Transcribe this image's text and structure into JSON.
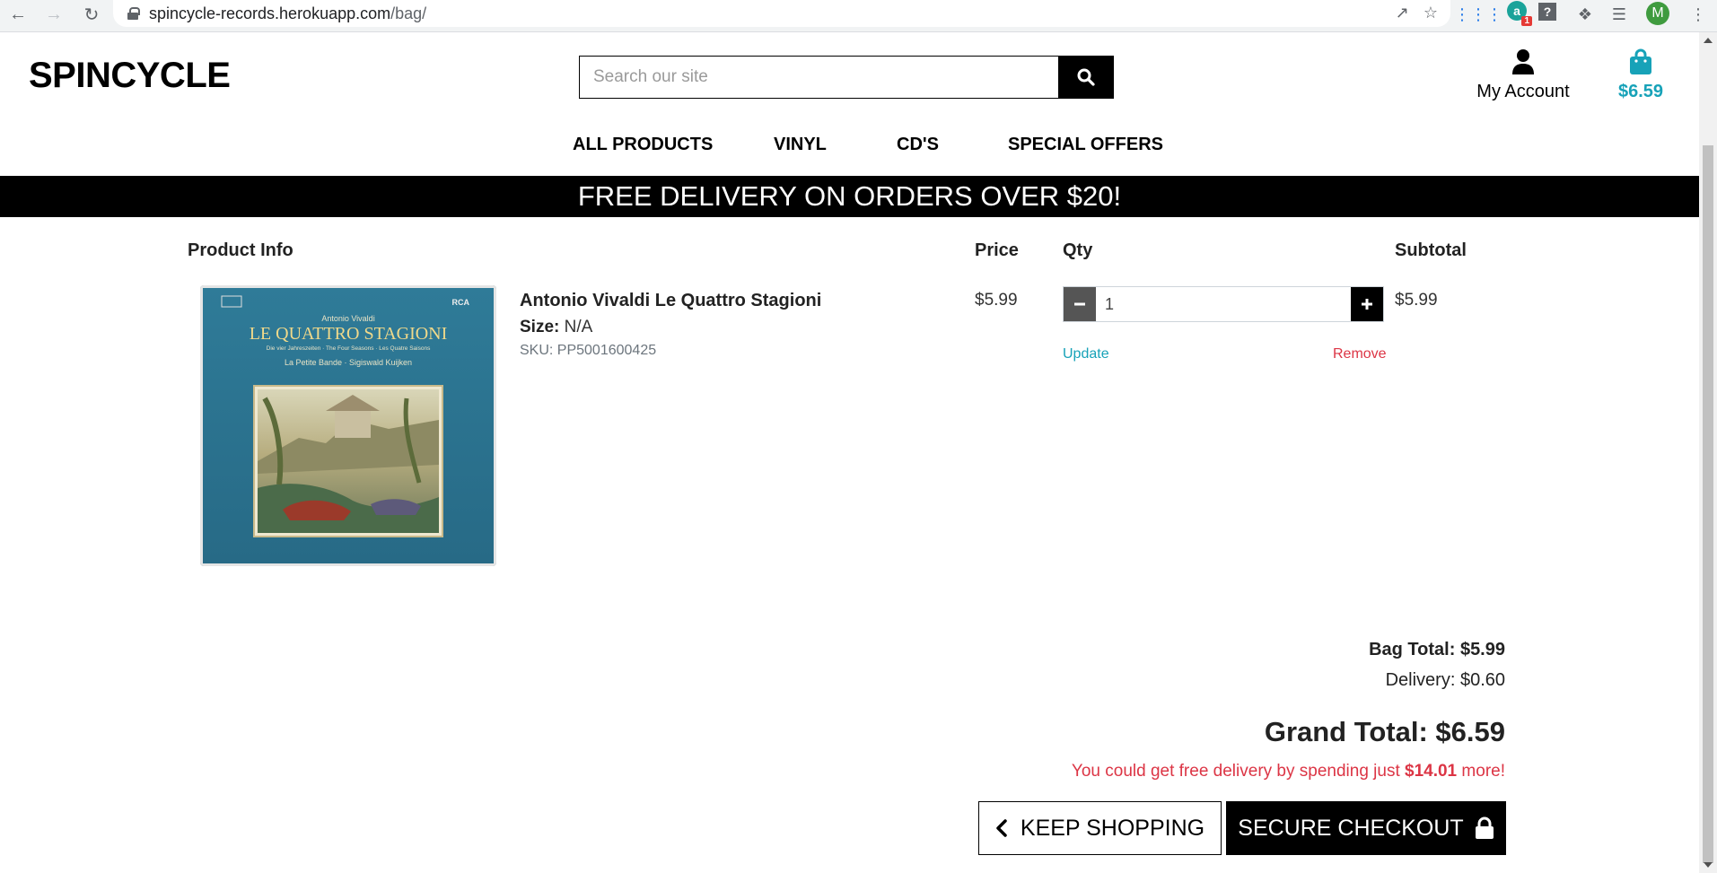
{
  "browser": {
    "url_host": "spincycle-records.herokuapp.com",
    "url_path": "/bag/",
    "avatar_letter": "M",
    "extension_badge": "1",
    "extension_letter": "a"
  },
  "header": {
    "logo": "SPINCYCLE",
    "search_placeholder": "Search our site",
    "account_label": "My Account",
    "bag_total": "$6.59"
  },
  "nav": {
    "items": [
      "ALL PRODUCTS",
      "VINYL",
      "CD'S",
      "SPECIAL OFFERS"
    ]
  },
  "banner": "FREE DELIVERY ON ORDERS OVER $20!",
  "table": {
    "headers": {
      "product": "Product Info",
      "price": "Price",
      "qty": "Qty",
      "subtotal": "Subtotal"
    }
  },
  "item": {
    "name": "Antonio Vivaldi Le Quattro Stagioni",
    "size_label": "Size:",
    "size_value": "N/A",
    "sku": "SKU: PP5001600425",
    "price": "$5.99",
    "qty": "1",
    "update": "Update",
    "remove": "Remove",
    "subtotal": "$5.99",
    "cover": {
      "composer": "Antonio Vivaldi",
      "title": "LE QUATTRO STAGIONI",
      "subtitle": "Die vier Jahreszeiten · The Four Seasons · Les Quatre Saisons",
      "performers": "La Petite Bande · Sigiswald Kuijken",
      "label": "RCA"
    }
  },
  "totals": {
    "bag_total": "Bag Total: $5.99",
    "delivery": "Delivery: $0.60",
    "grand_total": "Grand Total: $6.59",
    "free_prefix": "You could get free delivery by spending just ",
    "free_amount": "$14.01",
    "free_suffix": " more!"
  },
  "buttons": {
    "keep_shopping": "KEEP SHOPPING",
    "checkout": "SECURE CHECKOUT"
  },
  "colors": {
    "accent": "#17a2b8",
    "danger": "#dc3545",
    "dark": "#000000"
  }
}
